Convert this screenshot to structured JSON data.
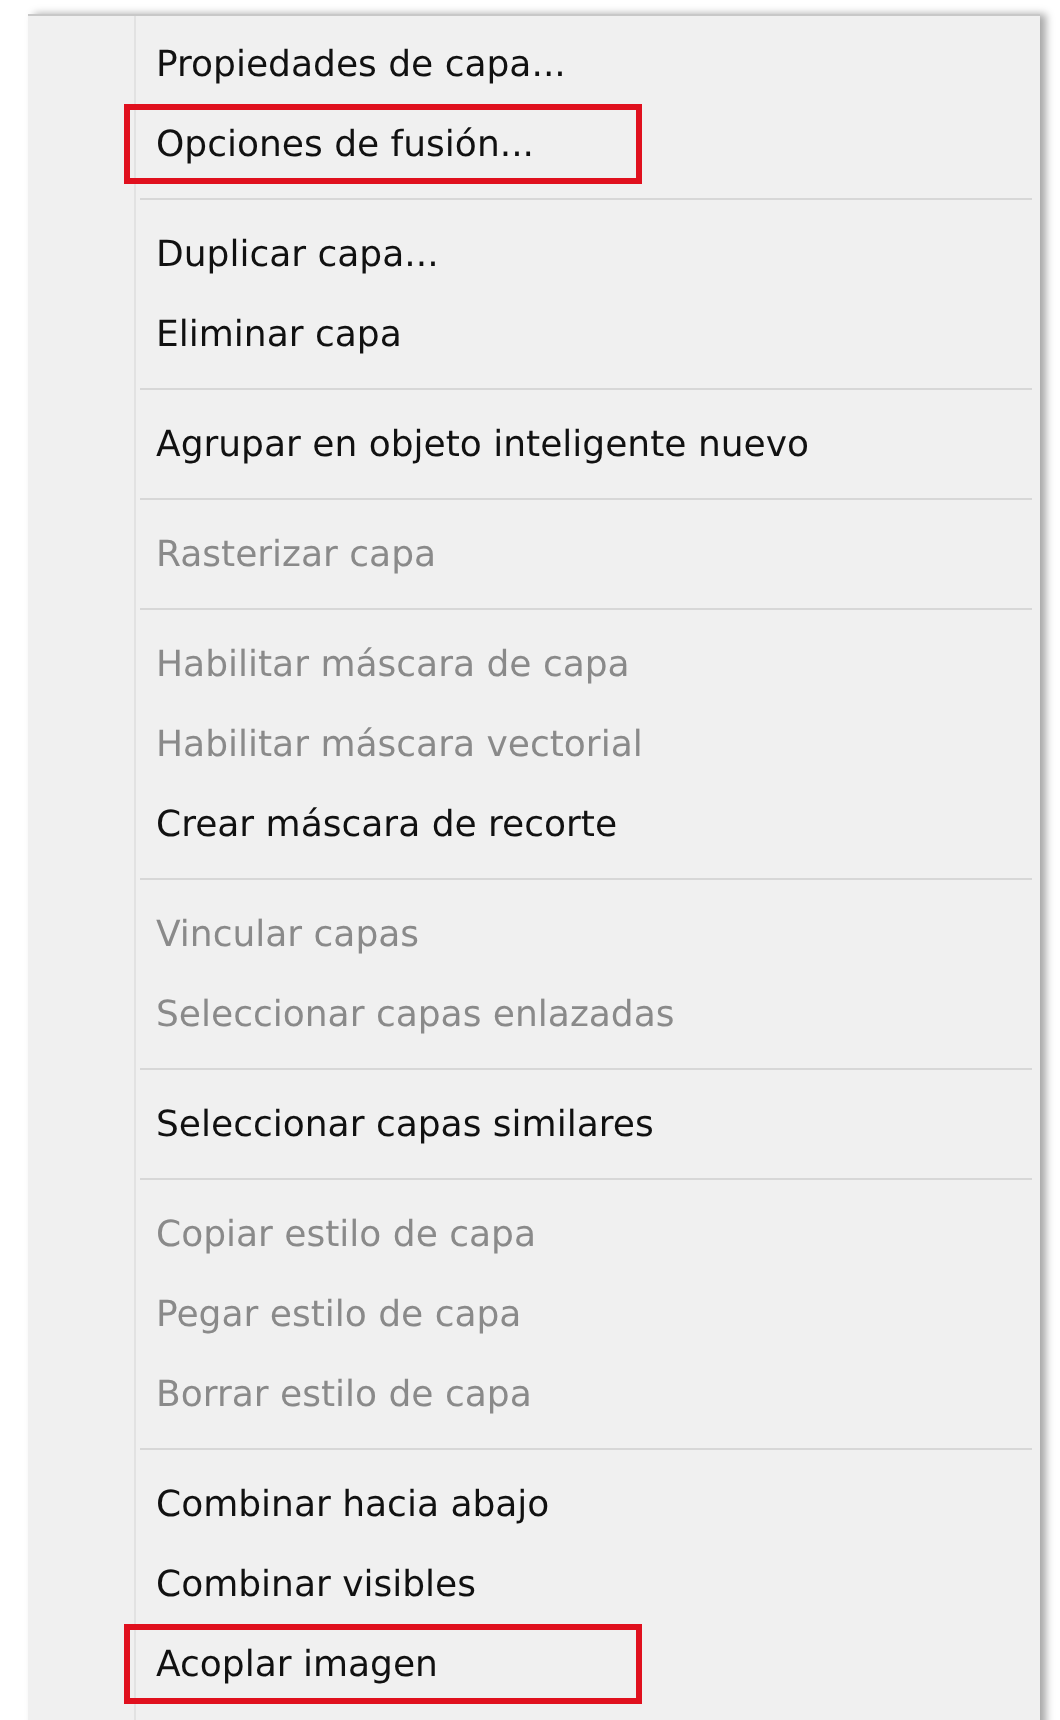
{
  "menu": {
    "groups": [
      {
        "items": [
          {
            "label": "Propiedades de capa...",
            "disabled": false,
            "highlighted": false
          },
          {
            "label": "Opciones de fusión...",
            "disabled": false,
            "highlighted": true
          }
        ]
      },
      {
        "items": [
          {
            "label": "Duplicar capa...",
            "disabled": false,
            "highlighted": false
          },
          {
            "label": "Eliminar capa",
            "disabled": false,
            "highlighted": false
          }
        ]
      },
      {
        "items": [
          {
            "label": "Agrupar en objeto inteligente nuevo",
            "disabled": false,
            "highlighted": false
          }
        ]
      },
      {
        "items": [
          {
            "label": "Rasterizar capa",
            "disabled": true,
            "highlighted": false
          }
        ]
      },
      {
        "items": [
          {
            "label": "Habilitar máscara de capa",
            "disabled": true,
            "highlighted": false
          },
          {
            "label": "Habilitar máscara vectorial",
            "disabled": true,
            "highlighted": false
          },
          {
            "label": "Crear máscara de recorte",
            "disabled": false,
            "highlighted": false
          }
        ]
      },
      {
        "items": [
          {
            "label": "Vincular capas",
            "disabled": true,
            "highlighted": false
          },
          {
            "label": "Seleccionar capas enlazadas",
            "disabled": true,
            "highlighted": false
          }
        ]
      },
      {
        "items": [
          {
            "label": "Seleccionar capas similares",
            "disabled": false,
            "highlighted": false
          }
        ]
      },
      {
        "items": [
          {
            "label": "Copiar estilo de capa",
            "disabled": true,
            "highlighted": false
          },
          {
            "label": "Pegar estilo de capa",
            "disabled": true,
            "highlighted": false
          },
          {
            "label": "Borrar estilo de capa",
            "disabled": true,
            "highlighted": false
          }
        ]
      },
      {
        "items": [
          {
            "label": "Combinar hacia abajo",
            "disabled": false,
            "highlighted": false
          },
          {
            "label": "Combinar visibles",
            "disabled": false,
            "highlighted": false
          },
          {
            "label": "Acoplar imagen",
            "disabled": false,
            "highlighted": true
          }
        ]
      }
    ]
  }
}
